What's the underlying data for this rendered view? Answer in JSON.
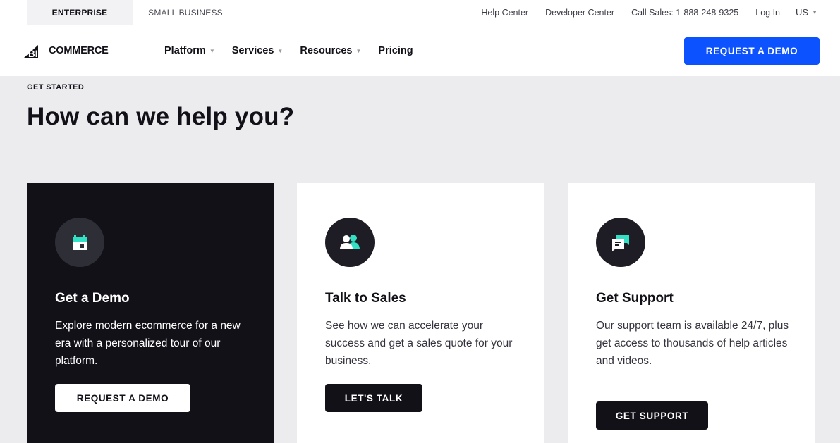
{
  "utility": {
    "segments": [
      "ENTERPRISE",
      "SMALL BUSINESS"
    ],
    "links": [
      "Help Center",
      "Developer Center",
      "Call Sales: 1-888-248-9325",
      "Log In"
    ],
    "region": "US"
  },
  "nav": {
    "logo_big": "BIG",
    "logo_rest": "COMMERCE",
    "items": [
      "Platform",
      "Services",
      "Resources",
      "Pricing"
    ],
    "demo_button": "REQUEST A DEMO"
  },
  "hero": {
    "eyebrow": "GET STARTED",
    "title": "How can we help you?"
  },
  "cards": [
    {
      "title": "Get a Demo",
      "desc": "Explore modern ecommerce for a new era with a personalized tour of our platform.",
      "button": "REQUEST A DEMO",
      "icon": "calendar-icon"
    },
    {
      "title": "Talk to Sales",
      "desc": "See how we can accelerate your success and get a sales quote for your business.",
      "button": "LET'S TALK",
      "icon": "people-icon"
    },
    {
      "title": "Get Support",
      "desc": "Our support team is available 24/7, plus get access to thousands of help articles and videos.",
      "button": "GET SUPPORT",
      "icon": "chat-bubbles-icon"
    }
  ],
  "colors": {
    "accent": "#0d52ff",
    "dark": "#121118",
    "teal": "#34e0c4",
    "background": "#ececef"
  }
}
